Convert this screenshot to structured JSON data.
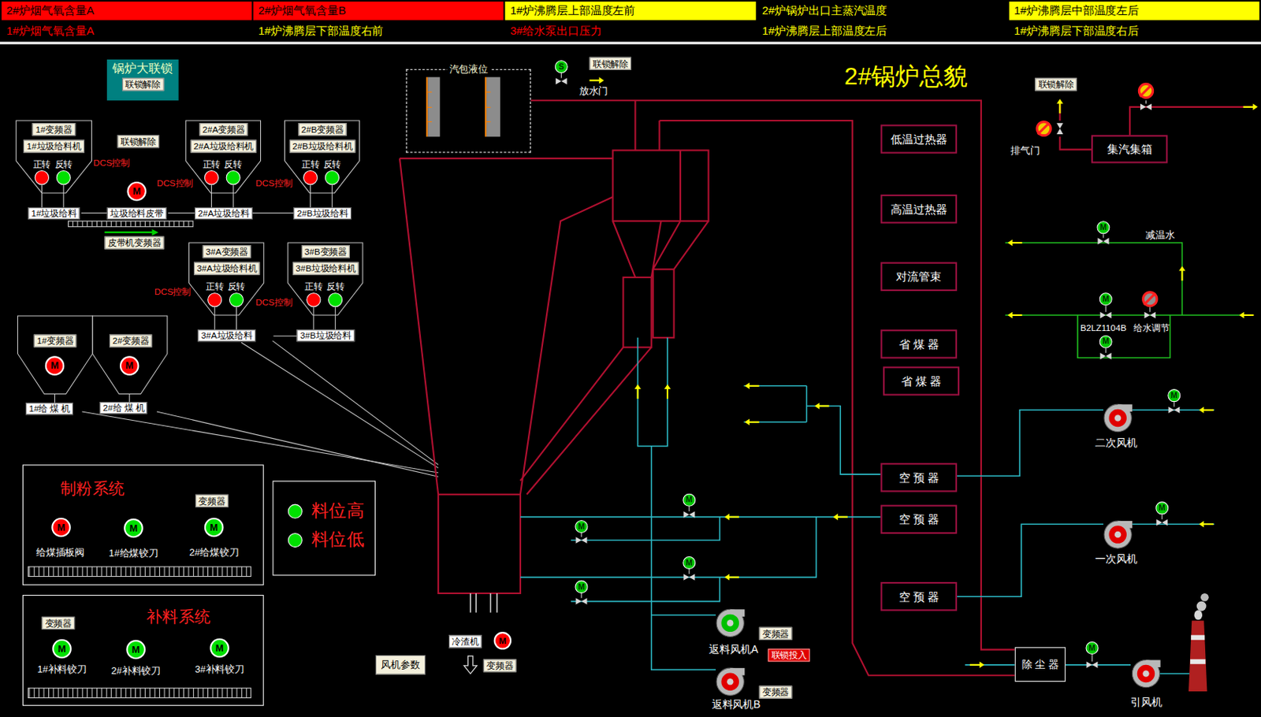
{
  "alarms": [
    {
      "text": "2#炉烟气氧含量A",
      "color": "#ff0000",
      "filled": true
    },
    {
      "text": "2#炉烟气氧含量B",
      "color": "#ff0000",
      "filled": true
    },
    {
      "text": "1#炉沸腾层上部温度左前",
      "color": "#ffff00",
      "filled": true
    },
    {
      "text": "2#炉锅炉出口主蒸汽温度",
      "color": "#ffff00",
      "filled": false
    },
    {
      "text": "1#炉沸腾层中部温度左后",
      "color": "#ffff00",
      "filled": true
    },
    {
      "text": "1#炉烟气氧含量A",
      "color": "#ff0000",
      "filled": false
    },
    {
      "text": "1#炉沸腾层下部温度右前",
      "color": "#ffff00",
      "filled": false
    },
    {
      "text": "3#给水泵出口压力",
      "color": "#ff0000",
      "filled": false
    },
    {
      "text": "1#炉沸腾层上部温度左后",
      "color": "#ffff00",
      "filled": false
    },
    {
      "text": "1#炉沸腾层下部温度右后",
      "color": "#ffff00",
      "filled": false
    }
  ],
  "title": "2#锅炉总貌",
  "boiler_interlock": {
    "title": "锅炉大联锁",
    "button": "联锁解除"
  },
  "feeder_interlock_button": "联锁解除",
  "garbage_feeders": [
    {
      "inverter": "1#变频器",
      "name": "1#垃圾给料机",
      "forward": {
        "label": "正转",
        "running": true
      },
      "reverse": {
        "label": "反转",
        "running": false
      },
      "feed": "1#垃圾给料",
      "control": "DCS控制"
    },
    {
      "inverter": "2#A变频器",
      "name": "2#A垃圾给料机",
      "forward": {
        "label": "正转",
        "running": true
      },
      "reverse": {
        "label": "反转",
        "running": false
      },
      "feed": "2#A垃圾给料",
      "control": "DCS控制"
    },
    {
      "inverter": "2#B变频器",
      "name": "2#B垃圾给料机",
      "forward": {
        "label": "正转",
        "running": true
      },
      "reverse": {
        "label": "反转",
        "running": false
      },
      "feed": "2#B垃圾给料",
      "control": "DCS控制"
    },
    {
      "inverter": "3#A变频器",
      "name": "3#A垃圾给料机",
      "forward": {
        "label": "正转",
        "running": true
      },
      "reverse": {
        "label": "反转",
        "running": false
      },
      "feed": "3#A垃圾给料",
      "control": "DCS控制"
    },
    {
      "inverter": "3#B变频器",
      "name": "3#B垃圾给料机",
      "forward": {
        "label": "正转",
        "running": true
      },
      "reverse": {
        "label": "反转",
        "running": false
      },
      "feed": "3#B垃圾给料",
      "control": "DCS控制"
    }
  ],
  "belt": {
    "name": "垃圾给料皮带",
    "motor": "M",
    "running": true,
    "inverter_button": "皮带机变频器"
  },
  "coal_feeders": [
    {
      "inverter": "1#变频器",
      "motor": "M",
      "running": true,
      "name": "1#给 煤 机"
    },
    {
      "inverter": "2#变频器",
      "motor": "M",
      "running": true,
      "name": "2#给 煤 机"
    }
  ],
  "powder_system": {
    "title": "制粉系统",
    "button": "变频器",
    "items": [
      {
        "label": "给煤插板阀",
        "motor": "M",
        "running": true
      },
      {
        "label": "1#给煤铰刀",
        "motor": "M",
        "running": false
      },
      {
        "label": "2#给煤铰刀",
        "motor": "M",
        "running": false
      }
    ]
  },
  "supply_system": {
    "title": "补料系统",
    "button": "变频器",
    "items": [
      {
        "label": "1#补料铰刀",
        "motor": "M",
        "running": false
      },
      {
        "label": "2#补料铰刀",
        "motor": "M",
        "running": false
      },
      {
        "label": "3#补料铰刀",
        "motor": "M",
        "running": false
      }
    ]
  },
  "legend": [
    {
      "label": "料位高",
      "color": "#00e000"
    },
    {
      "label": "料位低",
      "color": "#00e000"
    }
  ],
  "drum": {
    "title": "汽包液位",
    "levels": [
      1,
      1
    ]
  },
  "drain_valve": {
    "label": "放水门",
    "icon": "S",
    "button": "联锁解除"
  },
  "vent_valve": {
    "label": "排气门",
    "fault": true,
    "button": "联锁解除"
  },
  "steam_header": {
    "label": "集汽集箱",
    "valve_fault": true
  },
  "heat_surfaces": [
    "低温过热器",
    "高温过热器",
    "对流管束",
    "省 煤 器",
    "省 煤 器",
    "空 预 器",
    "空 预 器",
    "空 预 器"
  ],
  "water": {
    "desuperheat": {
      "label": "减温水",
      "valve": "M"
    },
    "feed": {
      "label": "B2LZ1104B",
      "valve": "M"
    },
    "regulator": {
      "label": "给水调节",
      "fault": true
    },
    "bypass_valve": "M"
  },
  "air_valves": [
    "M",
    "M",
    "M",
    "M"
  ],
  "fans": [
    {
      "label": "二次风机",
      "running": true,
      "valve": "M"
    },
    {
      "label": "一次风机",
      "running": true,
      "valve": "M"
    },
    {
      "label": "返料风机A",
      "running": false,
      "button": "变频器"
    },
    {
      "label": "返料风机B",
      "running": true,
      "button": "变频器"
    },
    {
      "label": "引风机",
      "running": true,
      "valve": "M"
    }
  ],
  "interlock_on_button": "联锁投入",
  "slag_cooler": {
    "label": "冷渣机",
    "motor": "M",
    "running": true,
    "button": "变频器"
  },
  "fan_params_button": "风机参数",
  "dust_collector": "除 尘 器"
}
